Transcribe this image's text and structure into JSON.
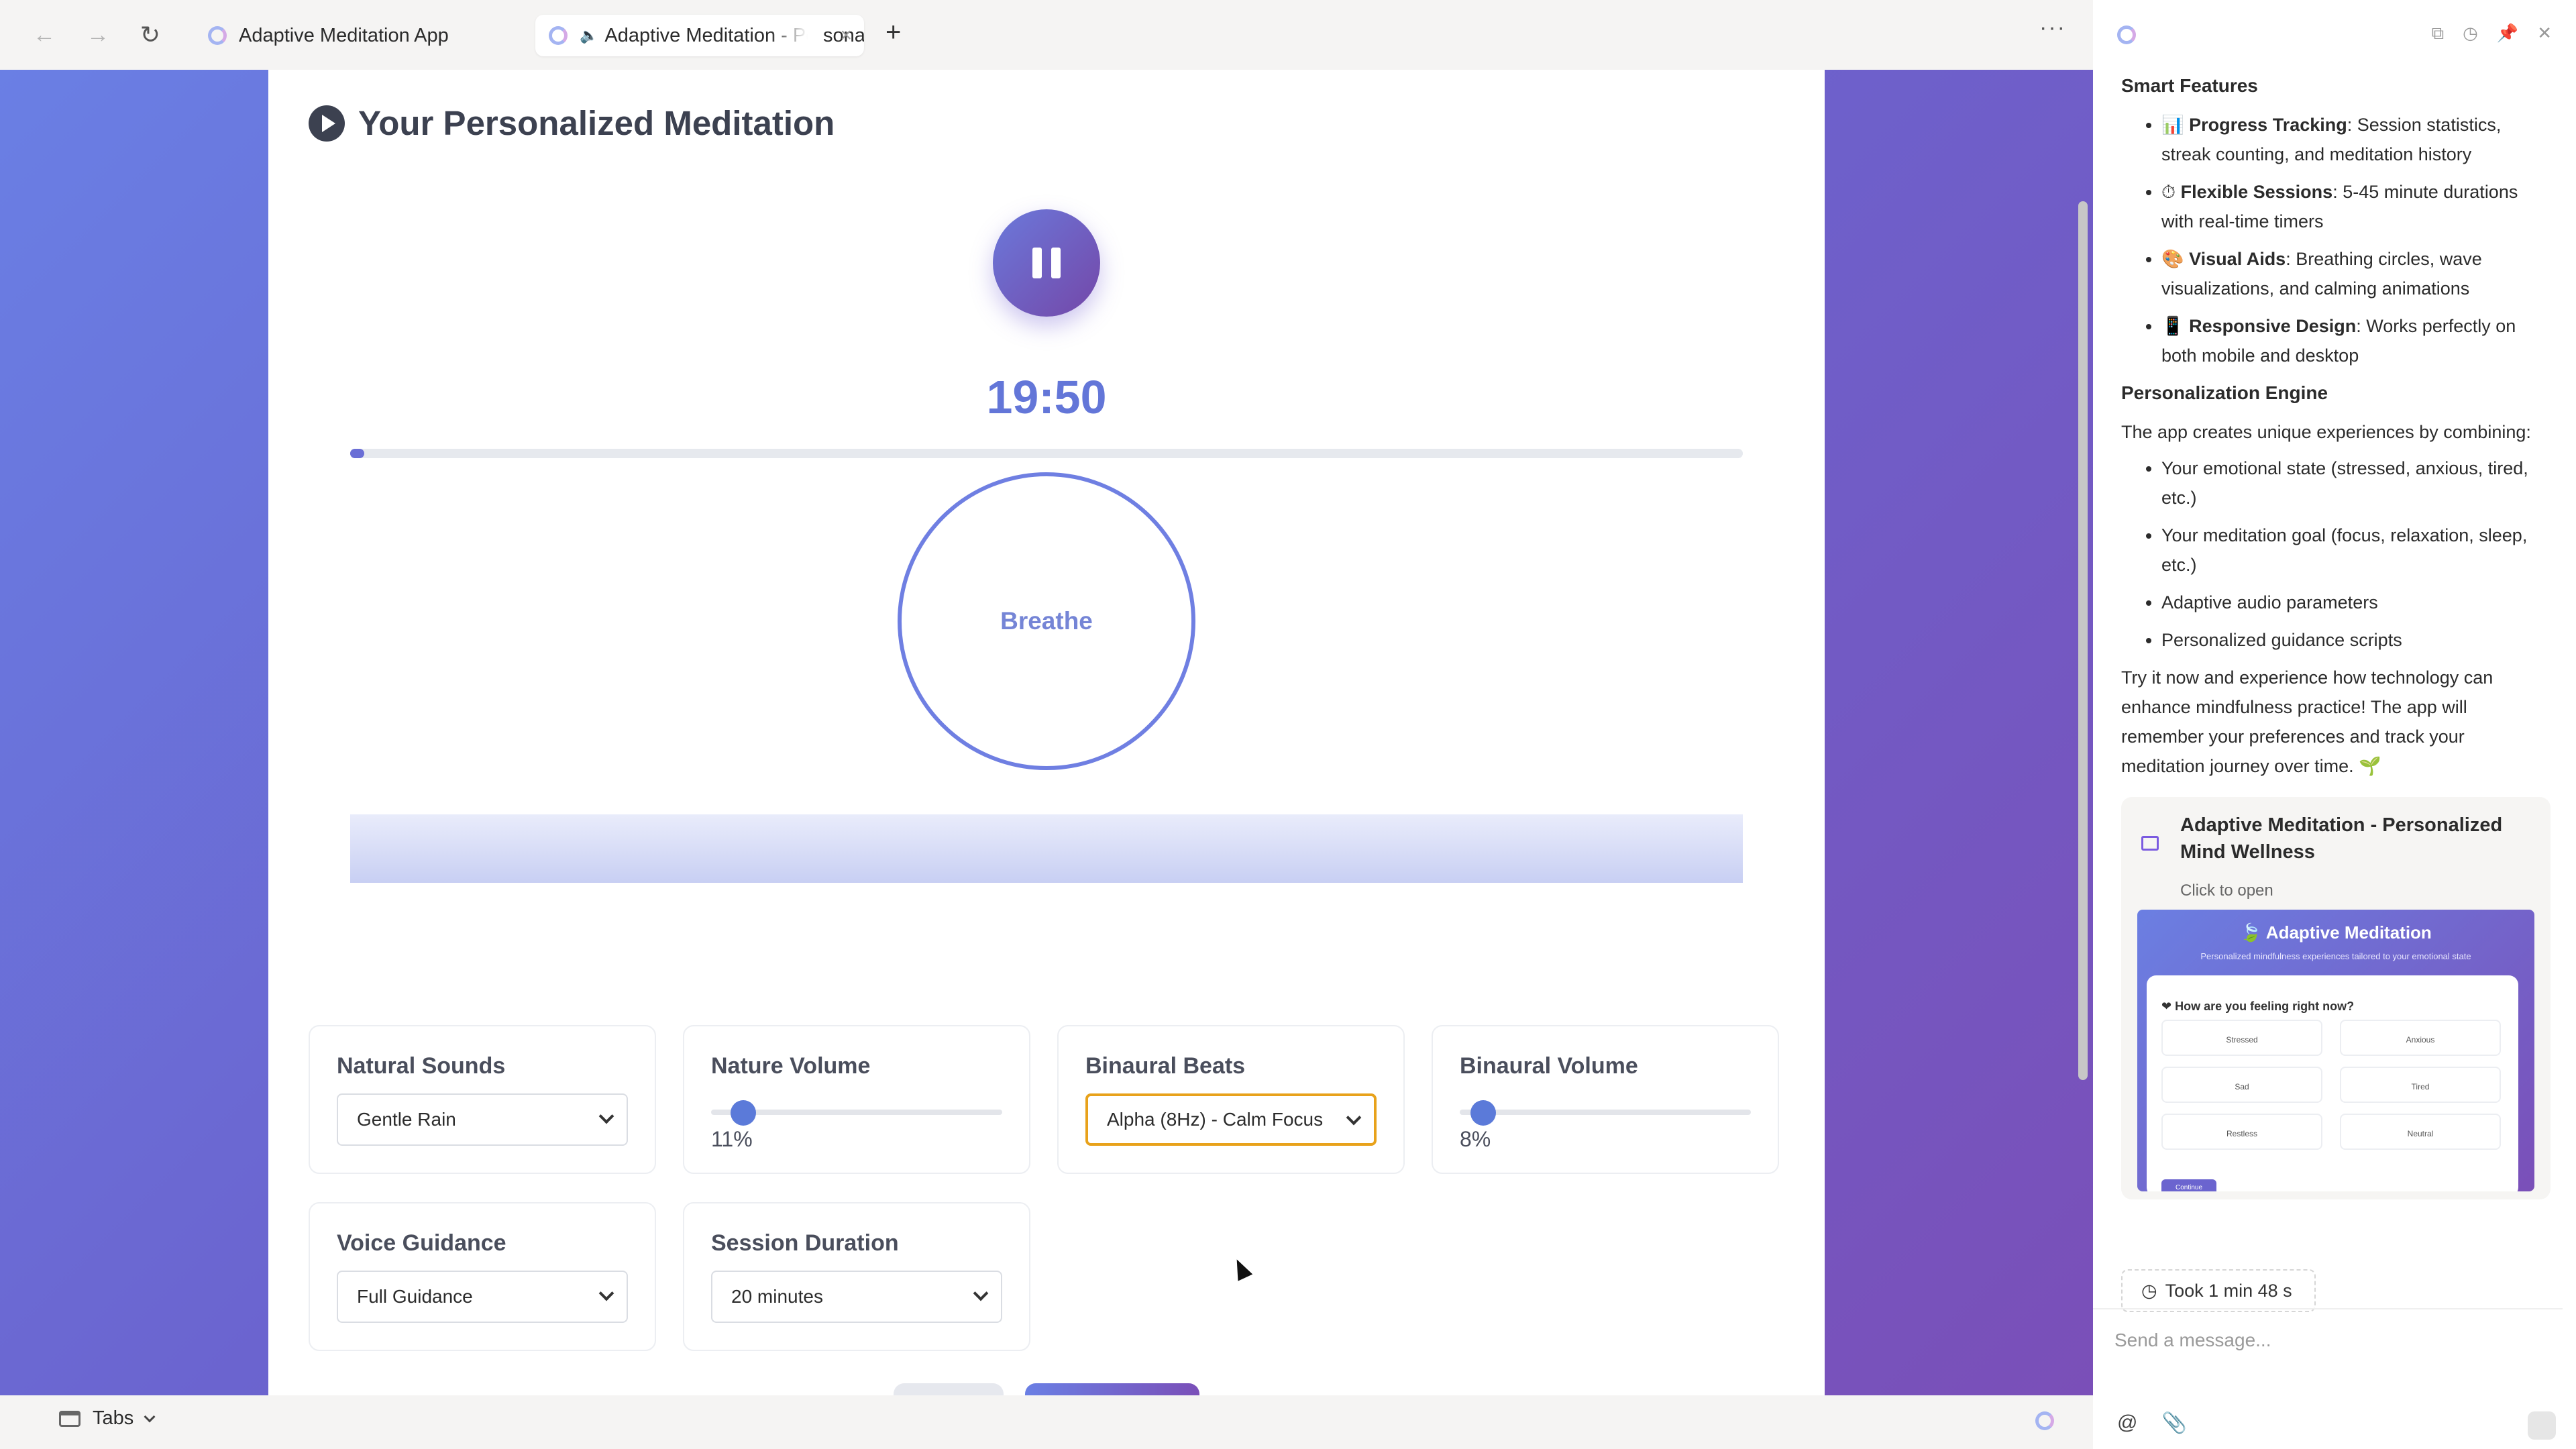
{
  "browser": {
    "tabs": [
      {
        "label": "Adaptive Meditation App"
      },
      {
        "label": "Adaptive Meditation - Personalized Mind Wellness",
        "close_icon": "×"
      }
    ],
    "new_tab": "+",
    "more": "···",
    "nav": {
      "back": "←",
      "forward": "→",
      "reload": "↻"
    }
  },
  "app": {
    "title": "Your Personalized Meditation",
    "timer": "19:50",
    "progress_fraction": 0.01,
    "breath_label": "Breathe",
    "controls": {
      "natural_sounds": {
        "label": "Natural Sounds",
        "value": "Gentle Rain"
      },
      "nature_volume": {
        "label": "Nature Volume",
        "value": "11%",
        "fraction": 0.11
      },
      "binaural_beats": {
        "label": "Binaural Beats",
        "value": "Alpha (8Hz) - Calm Focus"
      },
      "binaural_volume": {
        "label": "Binaural Volume",
        "value": "8%",
        "fraction": 0.08
      },
      "voice_guidance": {
        "label": "Voice Guidance",
        "value": "Full Guidance"
      },
      "session_duration": {
        "label": "Session Duration",
        "value": "20 minutes"
      }
    }
  },
  "bottombar": {
    "tabs_label": "Tabs"
  },
  "side": {
    "smart_features_heading": "Smart Features",
    "smart_features": [
      {
        "emoji": "📊",
        "title": "Progress Tracking",
        "text": ": Session statistics, streak counting, and meditation history"
      },
      {
        "emoji": "⏱",
        "title": "Flexible Sessions",
        "text": ": 5-45 minute durations with real-time timers"
      },
      {
        "emoji": "🎨",
        "title": "Visual Aids",
        "text": ": Breathing circles, wave visualizations, and calming animations"
      },
      {
        "emoji": "📱",
        "title": "Responsive Design",
        "text": ": Works perfectly on both mobile and desktop"
      }
    ],
    "engine_heading": "Personalization Engine",
    "engine_intro": "The app creates unique experiences by combining:",
    "engine_items": [
      "Your emotional state (stressed, anxious, tired, etc.)",
      "Your meditation goal (focus, relaxation, sleep, etc.)",
      "Adaptive audio parameters",
      "Personalized guidance scripts"
    ],
    "closing": "Try it now and experience how technology can enhance mindfulness practice! The app will remember your preferences and track your meditation journey over time. 🌱",
    "attachment": {
      "title": "Adaptive Meditation - Personalized Mind Wellness",
      "subtitle": "Click to open",
      "thumb_title": "🍃 Adaptive Meditation",
      "thumb_subtitle": "Personalized mindfulness experiences tailored to your emotional state",
      "thumb_question": "❤ How are you feeling right now?",
      "moods": [
        "Stressed",
        "Anxious",
        "Sad",
        "Tired",
        "Restless",
        "Neutral"
      ],
      "thumb_button": "Continue"
    },
    "took": "Took 1 min 48 s",
    "message_placeholder": "Send a message..."
  }
}
